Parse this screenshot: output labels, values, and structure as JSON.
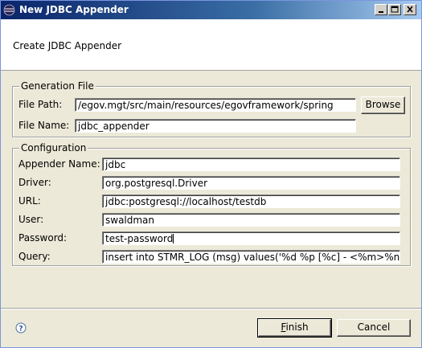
{
  "window": {
    "title": "New JDBC Appender",
    "icon": "eclipse-icon"
  },
  "banner": {
    "text": "Create JDBC Appender"
  },
  "generation_file": {
    "title": "Generation File",
    "file_path_label": "File Path:",
    "file_path_value": "/egov.mgt/src/main/resources/egovframework/spring",
    "browse_label": "Browse",
    "file_name_label": "File Name:",
    "file_name_value": "jdbc_appender"
  },
  "configuration": {
    "title": "Configuration",
    "fields": [
      {
        "label": "Appender Name:",
        "value": "jdbc"
      },
      {
        "label": "Driver:",
        "value": "org.postgresql.Driver"
      },
      {
        "label": "URL:",
        "value": "jdbc:postgresql://localhost/testdb"
      },
      {
        "label": "User:",
        "value": "swaldman"
      },
      {
        "label": "Password:",
        "value": "test-password"
      },
      {
        "label": "Query:",
        "value": "insert into STMR_LOG (msg) values('%d %p [%c] - <%m>%n')"
      }
    ]
  },
  "footer": {
    "help_icon": "help-icon",
    "finish_label": "Finish",
    "finish_mnemonic": "F",
    "cancel_label": "Cancel"
  }
}
